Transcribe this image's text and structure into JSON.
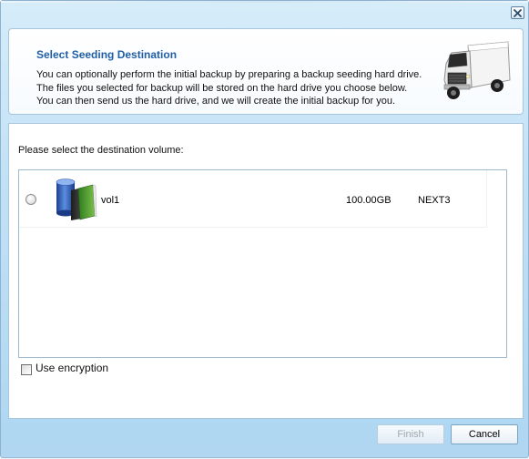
{
  "dialog": {
    "close_label": "×"
  },
  "header": {
    "title": "Select Seeding Destination",
    "lines": [
      "You can optionally perform the initial backup by preparing a backup seeding hard drive.",
      "The files you selected for backup will be stored on the hard drive you choose below.",
      "You can then send us the hard drive, and we will create the initial backup for you."
    ],
    "illustration_icon": "truck-icon"
  },
  "content": {
    "select_label": "Please select the destination volume:",
    "volumes": [
      {
        "name": "vol1",
        "size": "100.00GB",
        "filesystem": "NEXT3",
        "selected": false,
        "icon": "volume-icon"
      }
    ]
  },
  "options": {
    "use_encryption_label": "Use encryption",
    "use_encryption_checked": false
  },
  "buttons": {
    "finish_label": "Finish",
    "finish_enabled": false,
    "cancel_label": "Cancel"
  },
  "colors": {
    "title": "#1f5fa6",
    "window_bg": "#c2e1f6",
    "panel_border": "#a7c6dd"
  }
}
